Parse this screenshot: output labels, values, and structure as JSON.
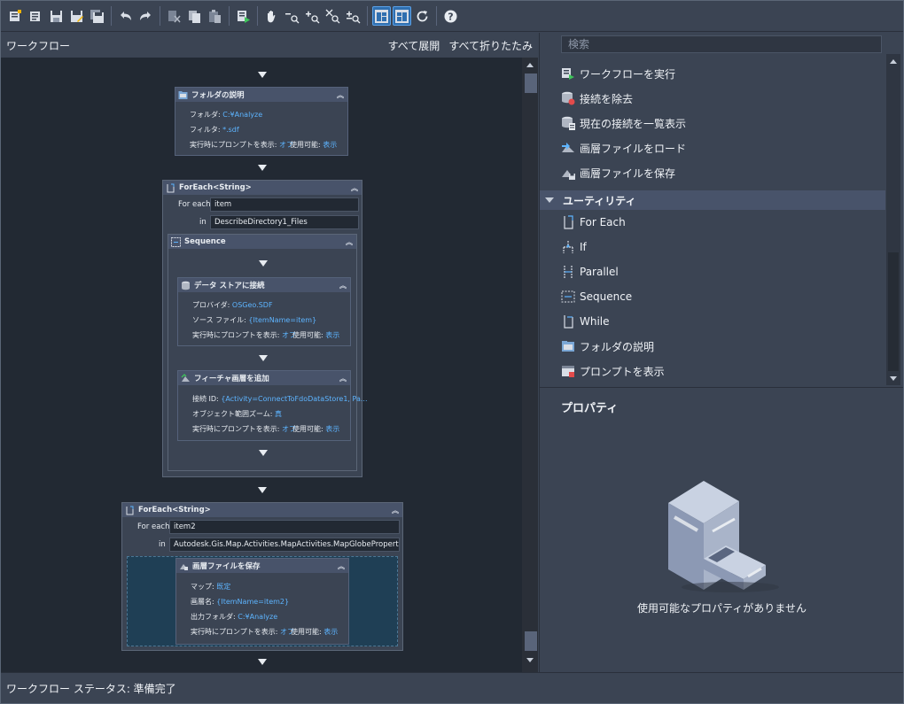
{
  "toolbar": {
    "icons": [
      "new-workflow-icon",
      "open-workflow-icon",
      "save-icon",
      "save-as-icon",
      "save-all-icon",
      "undo-icon",
      "redo-icon",
      "cut-icon",
      "copy-icon",
      "paste-icon",
      "run-icon",
      "pan-icon",
      "zoom-out-icon",
      "zoom-in-icon",
      "zoom-extents-icon",
      "zoom-window-icon",
      "layout-left-icon",
      "layout-right-icon",
      "refresh-icon",
      "help-icon"
    ]
  },
  "workflow": {
    "title": "ワークフロー",
    "expand_all": "すべて展開",
    "collapse_all": "すべて折りたたみ",
    "folder_desc": {
      "title": "フォルダの説明",
      "folder_label": "フォルダ:",
      "folder_value": "C:¥Analyze",
      "filter_label": "フィルタ:",
      "filter_value": "*.sdf",
      "prompt_label": "実行時にプロンプトを表示:",
      "prompt_value": "オフ",
      "enabled_label": "使用可能:",
      "enabled_value": "表示"
    },
    "foreach1": {
      "title": "ForEach<String>",
      "for_each_label": "For each",
      "for_each_value": "item",
      "in_label": "in",
      "in_value": "DescribeDirectory1_Files",
      "sequence_title": "Sequence",
      "connect": {
        "title": "データ ストアに接続",
        "provider_label": "プロバイダ:",
        "provider_value": "OSGeo.SDF",
        "source_label": "ソース ファイル:",
        "source_value": "{ItemName=item}",
        "prompt_label": "実行時にプロンプトを表示:",
        "prompt_value": "オフ",
        "enabled_label": "使用可能:",
        "enabled_value": "表示"
      },
      "add_layer": {
        "title": "フィーチャ画層を追加",
        "conn_label": "接続 ID:",
        "conn_value": "{Activity=ConnectToFdoDataStore1, Pa...",
        "zoom_label": "オブジェクト範囲ズーム:",
        "zoom_value": "真",
        "prompt_label": "実行時にプロンプトを表示:",
        "prompt_value": "オフ",
        "enabled_label": "使用可能:",
        "enabled_value": "表示"
      }
    },
    "foreach2": {
      "title": "ForEach<String>",
      "for_each_label": "For each",
      "for_each_value": "item2",
      "in_label": "in",
      "in_value": "Autodesk.Gis.Map.Activities.MapActivities.MapGlobeProperties.Layers",
      "save_layer": {
        "title": "画層ファイルを保存",
        "map_label": "マップ:",
        "map_value": "既定",
        "layer_label": "画層名:",
        "layer_value": "{ItemName=item2}",
        "out_label": "出力フォルダ:",
        "out_value": "C:¥Analyze",
        "prompt_label": "実行時にプロンプトを表示:",
        "prompt_value": "オフ",
        "enabled_label": "使用可能:",
        "enabled_value": "表示"
      }
    }
  },
  "library": {
    "search_placeholder": "検索",
    "items": [
      {
        "label": "ワークフローを実行",
        "icon": "run-workflow-icon"
      },
      {
        "label": "接続を除去",
        "icon": "remove-connection-icon"
      },
      {
        "label": "現在の接続を一覧表示",
        "icon": "list-connections-icon"
      },
      {
        "label": "画層ファイルをロード",
        "icon": "load-layer-icon"
      },
      {
        "label": "画層ファイルを保存",
        "icon": "save-layer-icon"
      }
    ],
    "group": "ユーティリティ",
    "utility_items": [
      {
        "label": "For Each",
        "icon": "foreach-icon"
      },
      {
        "label": "If",
        "icon": "if-icon"
      },
      {
        "label": "Parallel",
        "icon": "parallel-icon"
      },
      {
        "label": "Sequence",
        "icon": "sequence-icon"
      },
      {
        "label": "While",
        "icon": "while-icon"
      },
      {
        "label": "フォルダの説明",
        "icon": "folder-describe-icon"
      },
      {
        "label": "プロンプトを表示",
        "icon": "show-prompt-icon"
      }
    ]
  },
  "properties": {
    "title": "プロパティ",
    "empty_message": "使用可能なプロパティがありません"
  },
  "status": {
    "text": "ワークフロー ステータス: 準備完了"
  },
  "colors": {
    "value_blue": "#5db4ff",
    "panel": "#3b4453",
    "canvas": "#222933",
    "accent": "#2f6fb0"
  }
}
